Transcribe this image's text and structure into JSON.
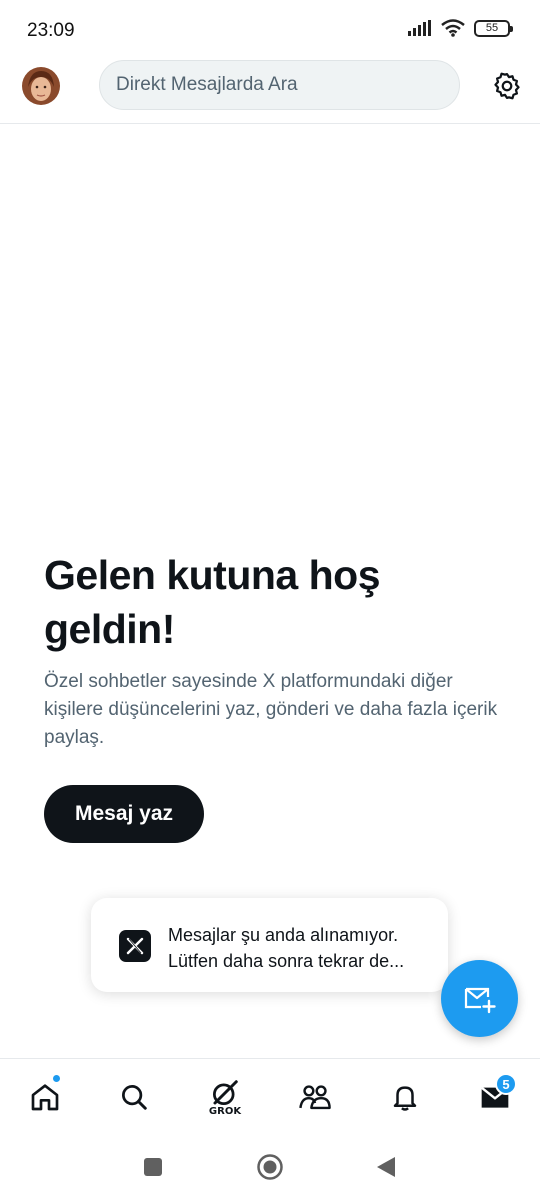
{
  "status_bar": {
    "time": "23:09",
    "battery": "55"
  },
  "header": {
    "search_placeholder": "Direkt Mesajlarda Ara"
  },
  "welcome": {
    "title": "Gelen kutuna hoş geldin!",
    "body": "Özel sohbetler sayesinde X platformundaki diğer kişilere düşüncelerini yaz, gönderi ve daha fazla içerik paylaş.",
    "button_label": "Mesaj yaz"
  },
  "toast": {
    "line1": "Mesajlar şu anda alınamıyor.",
    "line2": "Lütfen daha sonra tekrar de..."
  },
  "bottom_nav": {
    "items": [
      {
        "name": "home",
        "icon": "home-icon",
        "has_dot": true
      },
      {
        "name": "search",
        "icon": "search-icon"
      },
      {
        "name": "grok",
        "icon": "grok-icon",
        "label": "GROK"
      },
      {
        "name": "communities",
        "icon": "people-icon"
      },
      {
        "name": "notifications",
        "icon": "bell-icon"
      },
      {
        "name": "messages",
        "icon": "mail-icon",
        "badge": "5"
      }
    ]
  },
  "colors": {
    "accent": "#1d9bf0",
    "text": "#0f1419",
    "secondary": "#536471"
  }
}
